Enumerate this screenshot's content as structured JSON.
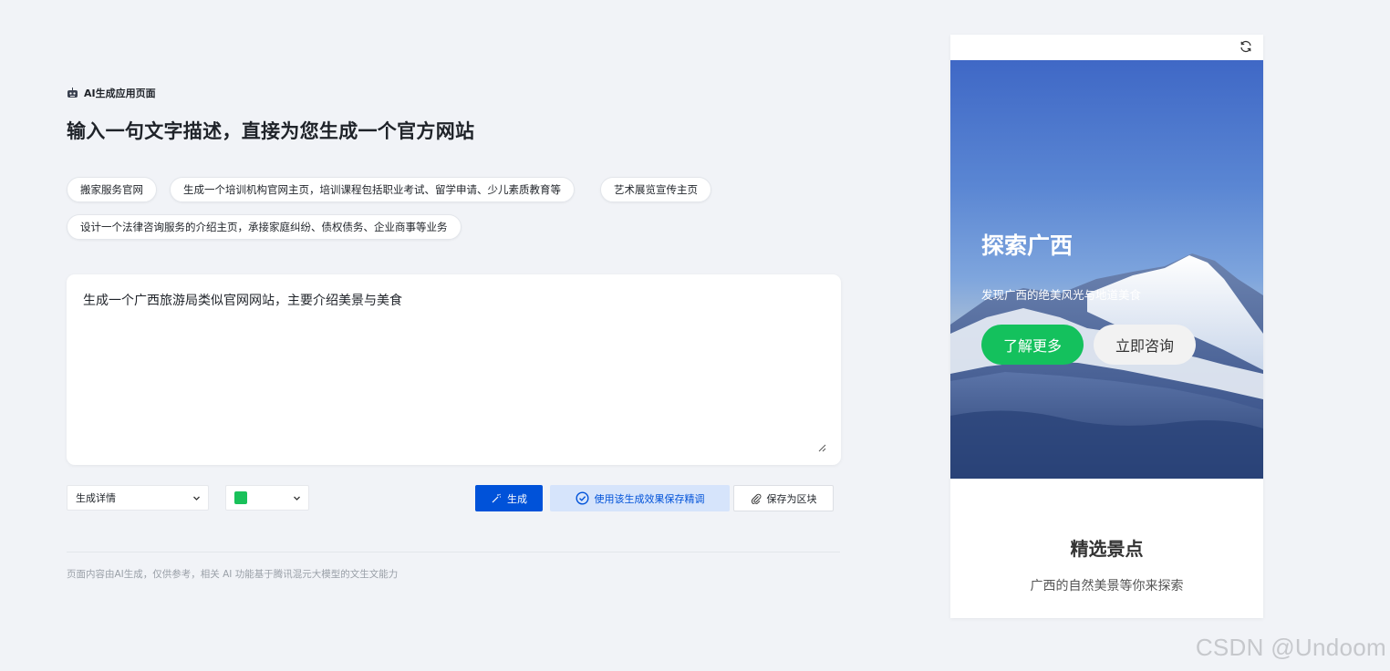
{
  "section_tag": {
    "label": "AI生成应用页面",
    "icon": "robot-icon"
  },
  "headline": "输入一句文字描述，直接为您生成一个官方网站",
  "chips": [
    "搬家服务官网",
    "生成一个培训机构官网主页，培训课程包括职业考试、留学申请、少儿素质教育等",
    "艺术展览宣传主页",
    "设计一个法律咨询服务的介绍主页，承接家庭纠纷、债权债务、企业商事等业务"
  ],
  "prompt": {
    "value": "生成一个广西旅游局类似官网网站，主要介绍美景与美食"
  },
  "toolbar": {
    "detail_select": "生成详情",
    "color_select": {
      "color": "#19c15a"
    },
    "generate_label": "生成",
    "save_tune_label": "使用该生成效果保存精调",
    "save_block_label": "保存为区块"
  },
  "disclaimer": "页面内容由AI生成，仅供参考，相关 AI 功能基于腾讯混元大模型的文生文能力",
  "preview": {
    "hero": {
      "title": "探索广西",
      "subtitle": "发现广西的绝美风光与地道美食",
      "primary_button": "了解更多",
      "secondary_button": "立即咨询"
    },
    "section": {
      "title": "精选景点",
      "subtitle": "广西的自然美景等你来探索"
    }
  },
  "watermark": "CSDN @Undoom",
  "colors": {
    "accent": "#0052d9",
    "accent_light": "#d6e4fb",
    "hero_button": "#14c15d"
  }
}
